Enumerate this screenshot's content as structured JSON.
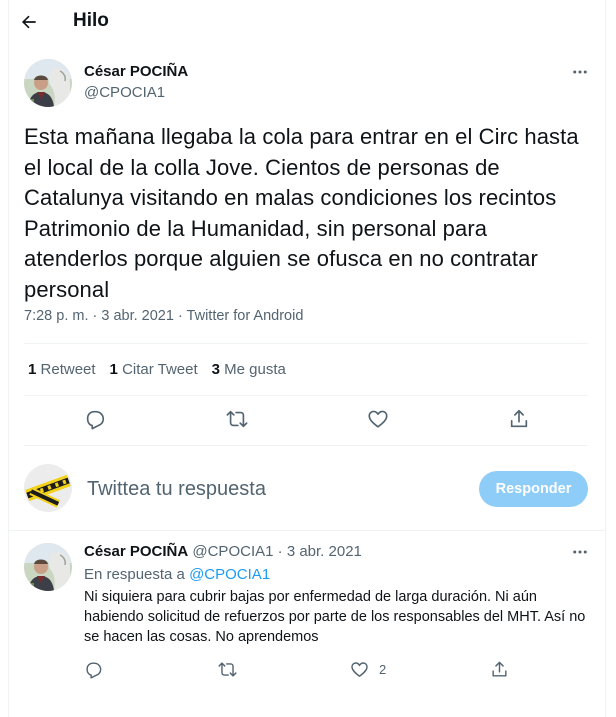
{
  "header": {
    "title": "Hilo"
  },
  "main_tweet": {
    "name": "César POCIÑA",
    "handle": "@CPOCIA1",
    "text": "Esta mañana llegaba la cola para entrar en el Circ hasta el local de la colla Jove. Cientos de personas de Catalunya visitando en malas condiciones los recintos Patrimonio de la Humanidad, sin personal para atenderlos porque alguien se ofusca en no contratar personal",
    "meta": "7:28 p. m. · 3 abr. 2021 · Twitter for Android",
    "stats": [
      {
        "count": "1",
        "label": "Retweet"
      },
      {
        "count": "1",
        "label": "Citar Tweet"
      },
      {
        "count": "3",
        "label": "Me gusta"
      }
    ],
    "actions": [
      "reply-icon",
      "retweet-icon",
      "like-icon",
      "share-icon"
    ]
  },
  "compose": {
    "placeholder": "Twittea tu respuesta",
    "button_label": "Responder"
  },
  "reply_tweet": {
    "name": "César POCIÑA",
    "handle": "@CPOCIA1",
    "separator": "·",
    "date": "3 abr. 2021",
    "in_reply_prefix": "En respuesta a",
    "in_reply_handle": "@CPOCIA1",
    "text": "Ni siquiera para cubrir bajas por enfermedad de larga duración. Ni aún habiendo solicitud de refuerzos por parte de los responsables del MHT. Así no se hacen las cosas. No aprendemos",
    "like_count": "2"
  },
  "colors": {
    "accent": "#1d9bf0",
    "button_disabled": "#8ecdf8",
    "secondary_text": "#536471",
    "divider": "#eff3f4"
  }
}
